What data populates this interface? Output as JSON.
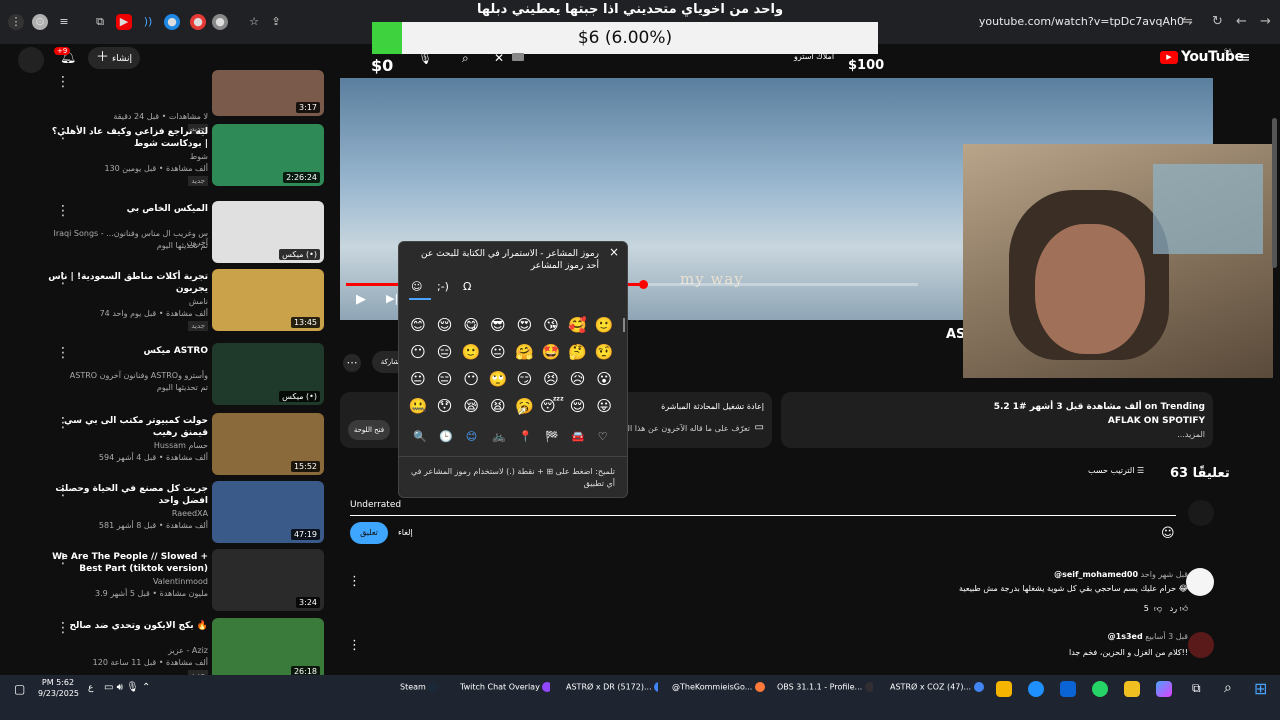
{
  "browser": {
    "url": "youtube.com/watch?v=tpDc7avqAh0"
  },
  "overlay": {
    "banner_title": "واحد من اخوياي متحديني اذا جبتها يعطيني دبلها",
    "goal_text": "$6 (6.00%)",
    "goal_fraction": 0.06,
    "goal_min": "$0",
    "goal_max": "$100",
    "goal_label": "املاك استرو",
    "colors": {
      "fill": "#3fd23f",
      "bar": "#f2f2f2"
    }
  },
  "youtube": {
    "logo_text": "YouTube",
    "region": "SA",
    "create_label": "إنشاء",
    "notif_count": "+9"
  },
  "recommendations": [
    {
      "title": "",
      "channel": "",
      "meta": "لا مشاهدات • قبل 24 دقيقة",
      "badge": "جديد",
      "duration": "3:17",
      "color": "#7a5a4a"
    },
    {
      "title": "ليه تراجع فزاعي وكيف عاد الأهلي؟ | بودكاست شوط",
      "channel": "شوط",
      "meta": "130 ألف مشاهدة • قبل يومين",
      "badge": "جديد",
      "duration": "2:26:24",
      "color": "#2e8b57"
    },
    {
      "title": "الميكس الخاص بي",
      "channel": "Iraqi Songs - ...س وغريب ال مناس وفنانون آخرون",
      "meta": "تم تحديثها اليوم",
      "badge": "",
      "duration": "ميكس (•)",
      "color": "#e0e0e0"
    },
    {
      "title": "تجربة أكلات مناطق السعودية! | ناس يجربون",
      "channel": "نامش",
      "meta": "74 ألف مشاهدة • قبل يوم واحد",
      "badge": "جديد",
      "duration": "13:45",
      "color": "#c9a24a"
    },
    {
      "title": "ميكس ASTRO",
      "channel": "ASTRO وفنانون آخرون ASTROوأسترو و",
      "meta": "تم تحديثها اليوم",
      "badge": "",
      "duration": "ميكس (•)",
      "color": "#1f3a2a"
    },
    {
      "title": "حولت كمبيوتر مكتب الى بي سي قيمنق رهيب",
      "channel": "Hussam حسام",
      "meta": "594 ألف مشاهدة • قبل 4 أشهر",
      "badge": "",
      "duration": "15:52",
      "color": "#8a6a3a"
    },
    {
      "title": "جربت كل مصنع في الحياة وحصلت افضل واحد",
      "channel": "RaeedXA",
      "meta": "581 ألف مشاهدة • قبل 8 أشهر",
      "badge": "",
      "duration": "47:19",
      "color": "#3a5a8a"
    },
    {
      "title": "We Are The People // Slowed + Best Part (tiktok version)",
      "channel": "Valentinmood",
      "meta": "3.9 مليون مشاهدة • قبل 5 أشهر",
      "badge": "",
      "duration": "3:24",
      "color": "#2a2a2a"
    },
    {
      "title": "بكج الايكون وتحدي ضد صالح 🔥",
      "channel": "عزيز - Aziz",
      "meta": "120 ألف مشاهدة • قبل 11 ساعة",
      "badge": "جديد",
      "duration": "26:18",
      "color": "#3a7a3a"
    }
  ],
  "player": {
    "progress_fraction": 0.52,
    "caption": "my way",
    "channel_tag": "AS"
  },
  "emoji_panel": {
    "title": "رموز المشاعر - الاستمرار في الكتابة للبحث عن أحد رموز المشاعر",
    "close": "×",
    "tabs": [
      "☺",
      ";-)",
      "Ω"
    ],
    "rows": [
      [
        "😊",
        "😌",
        "😋",
        "😎",
        "😍",
        "😘",
        "🥰",
        "🙂"
      ],
      [
        "😶",
        "😑",
        "🙂",
        "😐",
        "🤗",
        "🤩",
        "🤔",
        "🤨"
      ],
      [
        "😐",
        "😑",
        "😶",
        "🙄",
        "😏",
        "😣",
        "😥",
        "😮"
      ],
      [
        "🤐",
        "😯",
        "😪",
        "😫",
        "🥱",
        "😴",
        "😌",
        "😛"
      ]
    ],
    "categories": [
      "🔍",
      "🕒",
      "😊",
      "🚲",
      "📍",
      "🏁",
      "🚘",
      "♡"
    ],
    "hint": "تلميح: اضغط على ⊞ + نقطة (.) لاستخدام رموز المشاعر في أي تطبيق"
  },
  "info": {
    "views_line": "5.2 ألف مشاهدة قبل 3 أشهر #1 on Trending",
    "desc_title": "AFLAK ON SPOTIFY",
    "more": "...المزيد",
    "replay": "إعادة تشغيل المحادثة المباشرة",
    "replay_sub": "تعرّف على ما قاله الآخرون عن هذا البث",
    "chat_btn": "فتح اللوحة",
    "share": "مشاركة"
  },
  "comments": {
    "count_label": "63 تعليقًا",
    "sort_label": "الترتيب حسب",
    "draft": "Underrated",
    "cancel": "إلغاء",
    "submit": "تعليق",
    "items": [
      {
        "user": "@seif_mohamed00",
        "time": "قبل شهر واحد",
        "text": "حرام عليك يسم ساحجي بقي كل شوية يشغلها بدرجة مش طبيعية 😂",
        "likes": "5",
        "reply": "رد"
      },
      {
        "user": "@1s3ed",
        "time": "قبل 3 أسابيع",
        "text": "كلام من الغزل و الحزين، فخم جدا!!",
        "likes": "",
        "reply": "رد"
      }
    ]
  },
  "taskbar": {
    "time": "PM 5:62",
    "date": "9/23/2025",
    "lang": "ع",
    "items": [
      {
        "label": "Steam",
        "color": "#1b2838"
      },
      {
        "label": "Twitch Chat Overlay",
        "color": "#9146ff"
      },
      {
        "label": "ASTRØ x DR (5172)...",
        "color": "#4285f4"
      },
      {
        "label": "@TheKommieisGo...",
        "color": "#ff7a3a"
      },
      {
        "label": "OBS 31.1.1 - Profile...",
        "color": "#302e31"
      },
      {
        "label": "ASTRØ x COZ (47)...",
        "color": "#4285f4"
      }
    ]
  }
}
